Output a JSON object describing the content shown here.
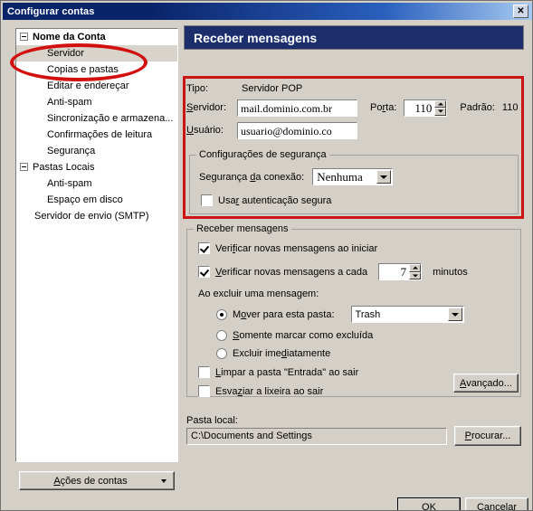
{
  "window": {
    "title": "Configurar contas",
    "close_label": "✕"
  },
  "sidebar": {
    "items": [
      {
        "label": "Nome da Conta",
        "level": "root",
        "expander": true,
        "selected": false
      },
      {
        "label": "Servidor",
        "level": "child",
        "expander": false,
        "selected": true
      },
      {
        "label": "Copias e pastas",
        "level": "child",
        "expander": false,
        "selected": false
      },
      {
        "label": "Editar e endereçar",
        "level": "child",
        "expander": false,
        "selected": false
      },
      {
        "label": "Anti-spam",
        "level": "child",
        "expander": false,
        "selected": false
      },
      {
        "label": "Sincronização e armazena...",
        "level": "child",
        "expander": false,
        "selected": false
      },
      {
        "label": "Confirmações de leitura",
        "level": "child",
        "expander": false,
        "selected": false
      },
      {
        "label": "Segurança",
        "level": "child",
        "expander": false,
        "selected": false
      },
      {
        "label": "Pastas Locais",
        "level": "root2",
        "expander": true,
        "selected": false
      },
      {
        "label": "Anti-spam",
        "level": "child",
        "expander": false,
        "selected": false
      },
      {
        "label": "Espaço em disco",
        "level": "child",
        "expander": false,
        "selected": false
      },
      {
        "label": "Servidor de envio (SMTP)",
        "level": "child2",
        "expander": false,
        "selected": false
      }
    ],
    "account_actions_label": "Ações de contas"
  },
  "pane": {
    "header": "Receber mensagens",
    "tipo_label": "Tipo:",
    "tipo_value": "Servidor POP",
    "servidor_label": "Servidor:",
    "servidor_value": "mail.dominio.com.br",
    "porta_label": "Porta:",
    "porta_value": "110",
    "padrao_label": "Padrão:",
    "padrao_value": "110",
    "usuario_label": "Usuário:",
    "usuario_value": "usuario@dominio.co"
  },
  "security_group": {
    "title": "Configurações de segurança",
    "connection_label": "Segurança da conexão:",
    "connection_value": "Nenhuma",
    "secure_auth_label": "Usar autenticação segura",
    "secure_auth_checked": false
  },
  "receive_group": {
    "title": "Receber mensagens",
    "check_on_start_label": "Verificar novas mensagens ao iniciar",
    "check_on_start_checked": true,
    "check_every_label": "Verificar novas mensagens a cada",
    "check_every_checked": true,
    "check_every_value": "7",
    "minutes_label": "minutos",
    "on_delete_label": "Ao excluir uma mensagem:",
    "radio_move_label": "Mover para esta pasta:",
    "radio_move_checked": true,
    "folder_value": "Trash",
    "radio_mark_label": "Somente marcar como excluída",
    "radio_mark_checked": false,
    "radio_delete_label": "Excluir imediatamente",
    "radio_delete_checked": false,
    "clean_inbox_label": "Limpar a pasta \"Entrada\" ao sair",
    "clean_inbox_checked": false,
    "empty_trash_label": "Esvaziar a lixeira ao sair",
    "empty_trash_checked": false,
    "advanced_label": "Avançado..."
  },
  "bottom": {
    "local_folder_label": "Pasta local:",
    "local_folder_value": "C:\\Documents and Settings",
    "browse_label": "Procurar...",
    "ok_label": "OK",
    "cancel_label": "Cancelar"
  },
  "annotations": {
    "color": "#cc1414"
  }
}
